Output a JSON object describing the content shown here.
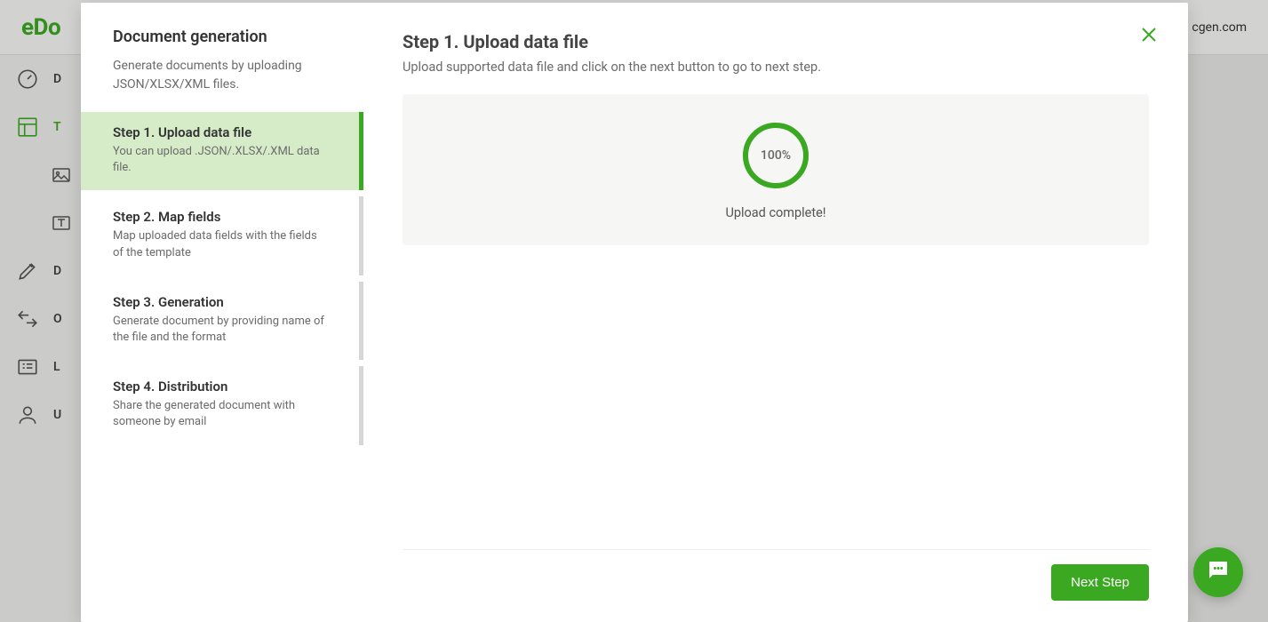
{
  "app": {
    "logo_prefix": "eDo",
    "header_right_suffix": "cgen.com"
  },
  "sidebar_bg": {
    "items": [
      {
        "label": "D",
        "icon": "gauge"
      },
      {
        "label": "T",
        "icon": "template",
        "active": true
      },
      {
        "label": "",
        "icon": "image",
        "sub": true
      },
      {
        "label": "",
        "icon": "text",
        "sub": true
      },
      {
        "label": "D",
        "icon": "pencil"
      },
      {
        "label": "O",
        "icon": "arrows"
      },
      {
        "label": "L",
        "icon": "list"
      },
      {
        "label": "U",
        "icon": "user"
      }
    ]
  },
  "modal": {
    "header": {
      "title": "Document generation",
      "description": "Generate documents by uploading JSON/XLSX/XML files."
    },
    "steps": [
      {
        "title": "Step 1. Upload data file",
        "description": "You can upload .JSON/.XLSX/.XML data file.",
        "active": true
      },
      {
        "title": "Step 2. Map fields",
        "description": "Map uploaded data fields with the fields of the template",
        "active": false
      },
      {
        "title": "Step 3. Generation",
        "description": "Generate document by providing name of the file and the format",
        "active": false
      },
      {
        "title": "Step 4. Distribution",
        "description": "Share the generated document with someone by email",
        "active": false
      }
    ],
    "main": {
      "title": "Step 1. Upload data file",
      "description": "Upload supported data file and click on the next button to go to next step.",
      "progress_percent": "100%",
      "status": "Upload complete!",
      "next_button": "Next Step"
    }
  },
  "colors": {
    "accent": "#3aa820"
  }
}
